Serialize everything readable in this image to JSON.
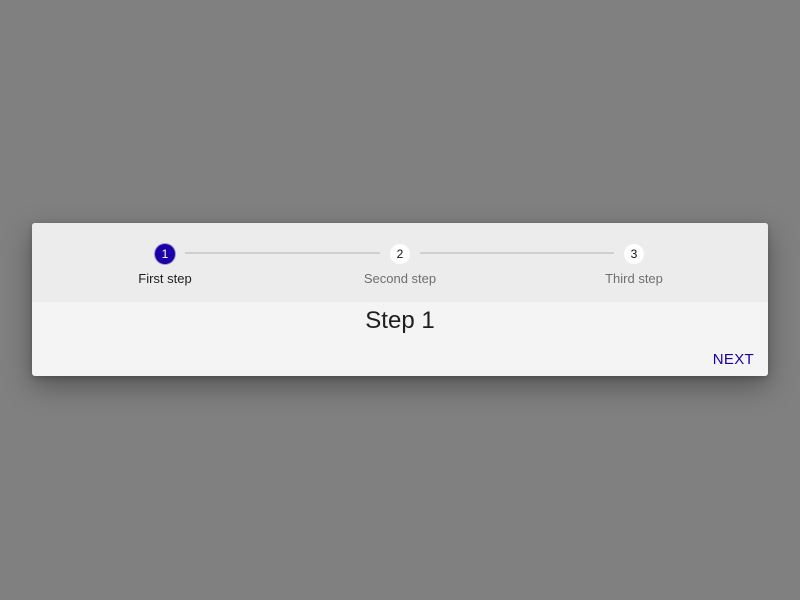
{
  "stepper": {
    "steps": [
      {
        "number": "1",
        "label": "First step",
        "state": "active"
      },
      {
        "number": "2",
        "label": "Second step",
        "state": "inactive"
      },
      {
        "number": "3",
        "label": "Third step",
        "state": "inactive"
      }
    ]
  },
  "content": {
    "title": "Step 1"
  },
  "actions": {
    "next_label": "NEXT"
  },
  "colors": {
    "accent": "#1a00a6",
    "backdrop": "#808080",
    "dialog_bg": "#f4f4f4",
    "stepper_bg": "#ececec"
  }
}
